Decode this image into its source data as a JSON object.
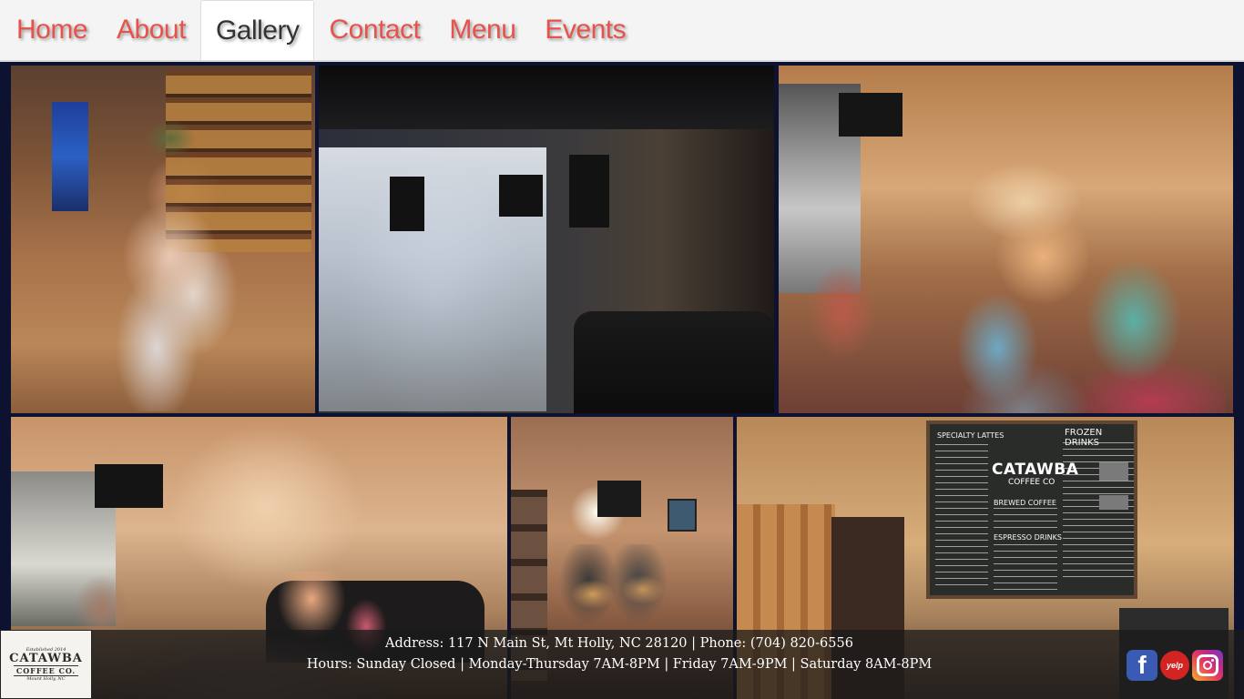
{
  "nav": {
    "items": [
      {
        "label": "Home",
        "active": false
      },
      {
        "label": "About",
        "active": false
      },
      {
        "label": "Gallery",
        "active": true
      },
      {
        "label": "Contact",
        "active": false
      },
      {
        "label": "Menu",
        "active": false
      },
      {
        "label": "Events",
        "active": false
      }
    ],
    "accent_color": "#e5534b"
  },
  "gallery": {
    "photos": [
      {
        "subject": "musician playing guitar in shop"
      },
      {
        "subject": "band performing in dark cafe"
      },
      {
        "subject": "children story time"
      },
      {
        "subject": "cafe seating area with audience"
      },
      {
        "subject": "guitar duo performing"
      },
      {
        "subject": "coffee counter with chalkboard menu"
      }
    ],
    "menu_board": {
      "brand": "CATAWBA",
      "brand_sub": "COFFEE CO",
      "heading_specialty": "SPECIALTY LATTES",
      "heading_frozen": "FROZEN DRINKS",
      "heading_brewed": "BREWED COFFEE",
      "heading_espresso": "ESPRESSO DRINKS"
    }
  },
  "footer": {
    "address_line": "Address: 117 N Main St, Mt Holly, NC 28120 | Phone: (704) 820-6556",
    "hours_line": "Hours: Sunday Closed | Monday-Thursday 7AM-8PM | Friday 7AM-9PM | Saturday 8AM-8PM",
    "logo": {
      "tagline": "Established 2014",
      "name": "CATAWBA",
      "sub": "COFFEE CO.",
      "city": "Mount Holly, NC"
    },
    "social": [
      {
        "icon": "facebook-icon",
        "glyph": "f"
      },
      {
        "icon": "yelp-icon",
        "glyph": "yelp"
      },
      {
        "icon": "instagram-icon",
        "glyph": ""
      }
    ]
  }
}
